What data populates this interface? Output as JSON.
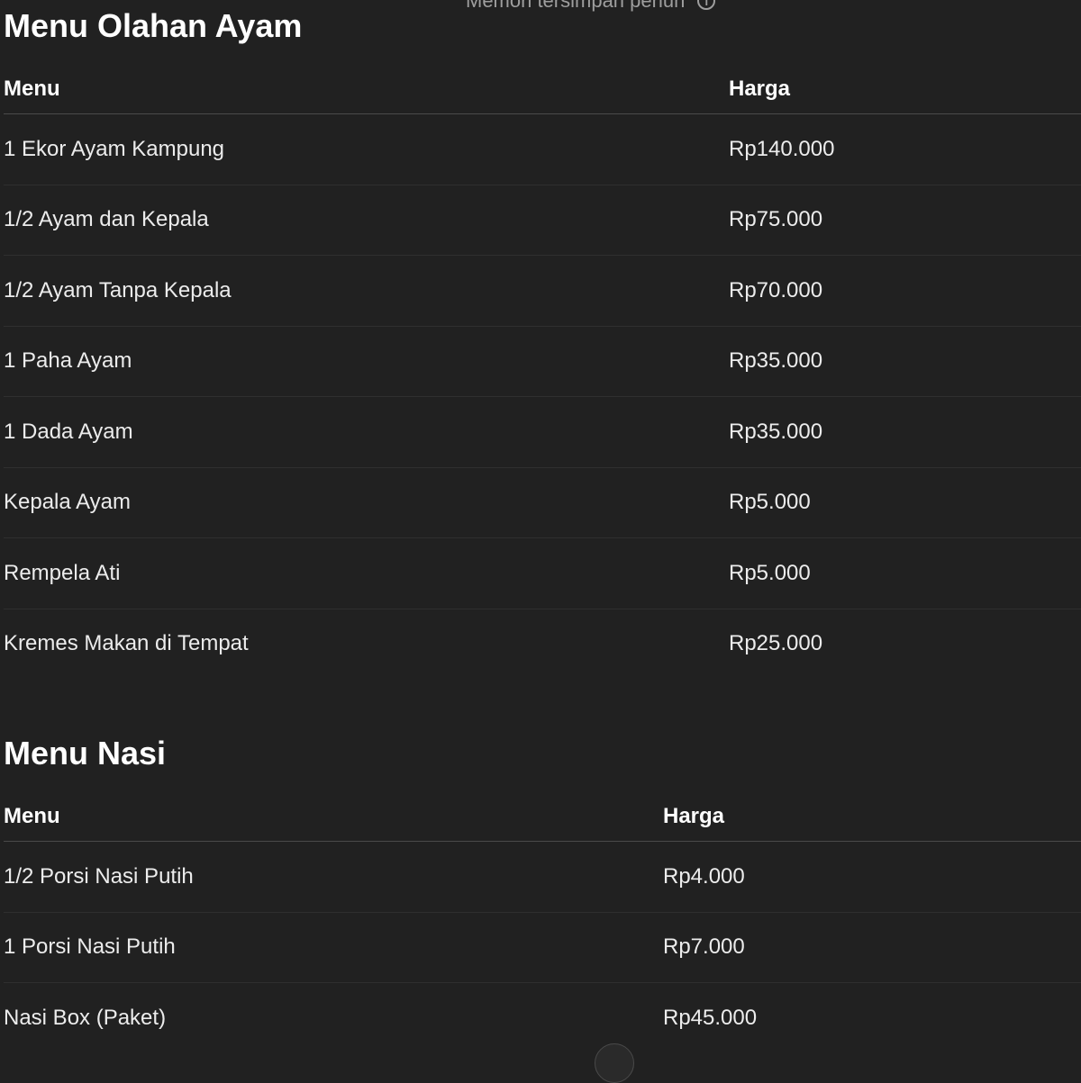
{
  "banner": {
    "text": "Memori tersimpan penuh",
    "icon": "info-icon"
  },
  "ayam": {
    "title": "Menu Olahan Ayam",
    "headers": {
      "menu": "Menu",
      "harga": "Harga"
    },
    "rows": [
      {
        "menu": "1 Ekor Ayam Kampung",
        "harga": "Rp140.000"
      },
      {
        "menu": "1/2 Ayam dan Kepala",
        "harga": "Rp75.000"
      },
      {
        "menu": "1/2 Ayam Tanpa Kepala",
        "harga": "Rp70.000"
      },
      {
        "menu": "1 Paha Ayam",
        "harga": "Rp35.000"
      },
      {
        "menu": "1 Dada Ayam",
        "harga": "Rp35.000"
      },
      {
        "menu": "Kepala Ayam",
        "harga": "Rp5.000"
      },
      {
        "menu": "Rempela Ati",
        "harga": "Rp5.000"
      },
      {
        "menu": "Kremes Makan di Tempat",
        "harga": "Rp25.000"
      }
    ]
  },
  "nasi": {
    "title": "Menu Nasi",
    "headers": {
      "menu": "Menu",
      "harga": "Harga"
    },
    "rows": [
      {
        "menu": "1/2 Porsi Nasi Putih",
        "harga": "Rp4.000"
      },
      {
        "menu": "1 Porsi Nasi Putih",
        "harga": "Rp7.000"
      },
      {
        "menu": "Nasi Box (Paket)",
        "harga": "Rp45.000"
      }
    ]
  }
}
